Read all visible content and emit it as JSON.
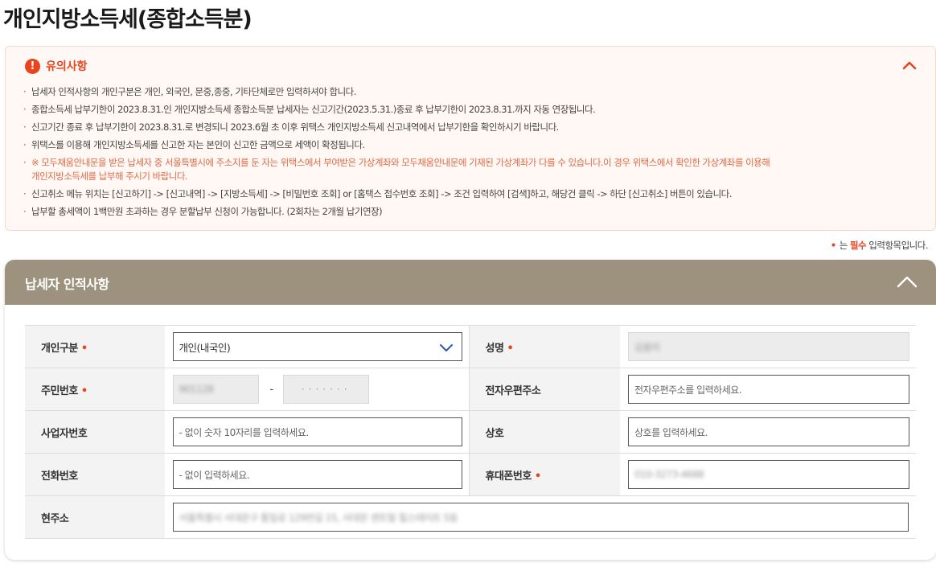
{
  "page": {
    "title": "개인지방소득세(종합소득분)"
  },
  "notice": {
    "title": "유의사항",
    "items": [
      "납세자 인적사항의 개인구분은 개인, 외국인, 문중,종중, 기타단체로만 입력하셔야 합니다.",
      "종합소득세 납부기한이 2023.8.31.인 개인지방소득세 종합소득분 납세자는 신고기간(2023.5.31.)종료 후 납부기한이 2023.8.31.까지 자동 연장됩니다.",
      "신고기간 종료 후 납부기한이 2023.8.31.로 변경되니 2023.6월 초 이후 위택스 개인지방소득세 신고내역에서 납부기한을 확인하시기 바랍니다.",
      "위택스를 이용해 개인지방소득세를 신고한 자는 본인이 신고한 금액으로 세액이 확정됩니다."
    ],
    "warn_line1": "※ 모두채움안내문을 받은 납세자 중 서울특별시에 주소지를 둔 자는 위택스에서 부여받은 가상계좌와 모두채움안내문에 기재된 가상계좌가 다를 수 있습니다.이 경우 위택스에서 확인한 가상계좌를 이용해",
    "warn_line2": "개인지방소득세를 납부해 주시기 바랍니다.",
    "items_after": [
      "신고취소 메뉴 위치는 [신고하기] -> [신고내역] -> [지방소득세] -> [비밀번호 조회] or [홈택스 접수번호 조회] -> 조건 입력하여 [검색]하고, 해당건 클릭 -> 하단 [신고취소] 버튼이 있습니다.",
      "납부할 총세액이 1백만원 초과하는 경우 분할납부 신청이 가능합니다. (2회차는 2개월 납기연장)"
    ]
  },
  "required_note": {
    "dot": "•",
    "prefix": "는",
    "strong": "필수",
    "suffix": "입력항목입니다."
  },
  "taxpayer": {
    "title": "납세자 인적사항",
    "req_mark": "•",
    "personal_type_label": "개인구분",
    "personal_type_value": "개인(내국인)",
    "name_label": "성명",
    "name_value": "김용미",
    "rrn_label": "주민번호",
    "rrn_front": "901128",
    "rrn_dash": "-",
    "rrn_back": "·······",
    "email_label": "전자우편주소",
    "email_placeholder": "전자우편주소를 입력하세요.",
    "bizno_label": "사업자번호",
    "bizno_placeholder": "- 없이 숫자 10자리를 입력하세요.",
    "company_label": "상호",
    "company_placeholder": "상호를 입력하세요.",
    "phone_label": "전화번호",
    "phone_placeholder": "- 없이 입력하세요.",
    "mobile_label": "휴대폰번호",
    "mobile_value": "010-3273-4688",
    "address_label": "현주소",
    "address_value": "서울특별시 서대문구 통일로 129번길 15, 서대문 센트럴 힐스테이트 5동"
  },
  "colors": {
    "accent": "#e8441d",
    "panel_header": "#9d927d",
    "notice_bg": "#fff8f5"
  },
  "icons": {
    "notice": "exclamation-circle-icon",
    "collapse": "chevron-up-icon",
    "select": "chevron-down-icon"
  }
}
